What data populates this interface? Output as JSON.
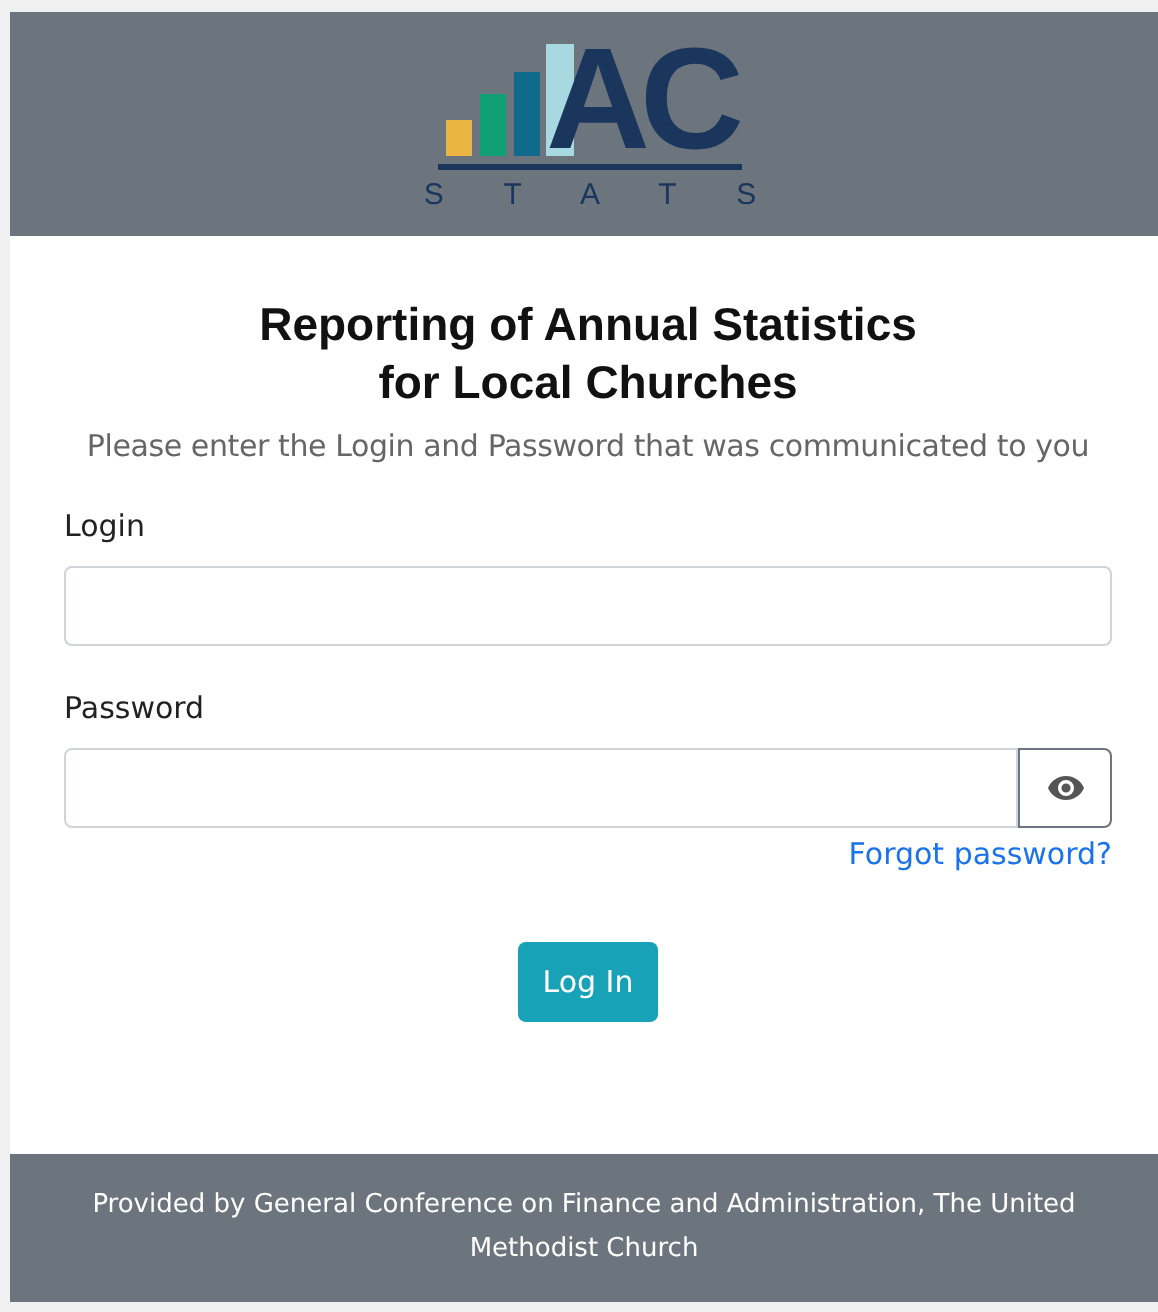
{
  "logo": {
    "letters": "AC",
    "subtitle": "S T A T S"
  },
  "title": {
    "line_1": "Reporting of Annual Statistics",
    "line_2": "for Local Churches"
  },
  "instructions": "Please enter the Login and Password that was communicated to you",
  "fields": [
    {
      "label": "Login",
      "kind": "text"
    },
    {
      "label": "Password",
      "kind": "password"
    }
  ],
  "forgot_link": "Forgot password?",
  "login_button": "Log In",
  "footer": "Provided by General Conference on Finance and Administration, The United Methodist Church"
}
